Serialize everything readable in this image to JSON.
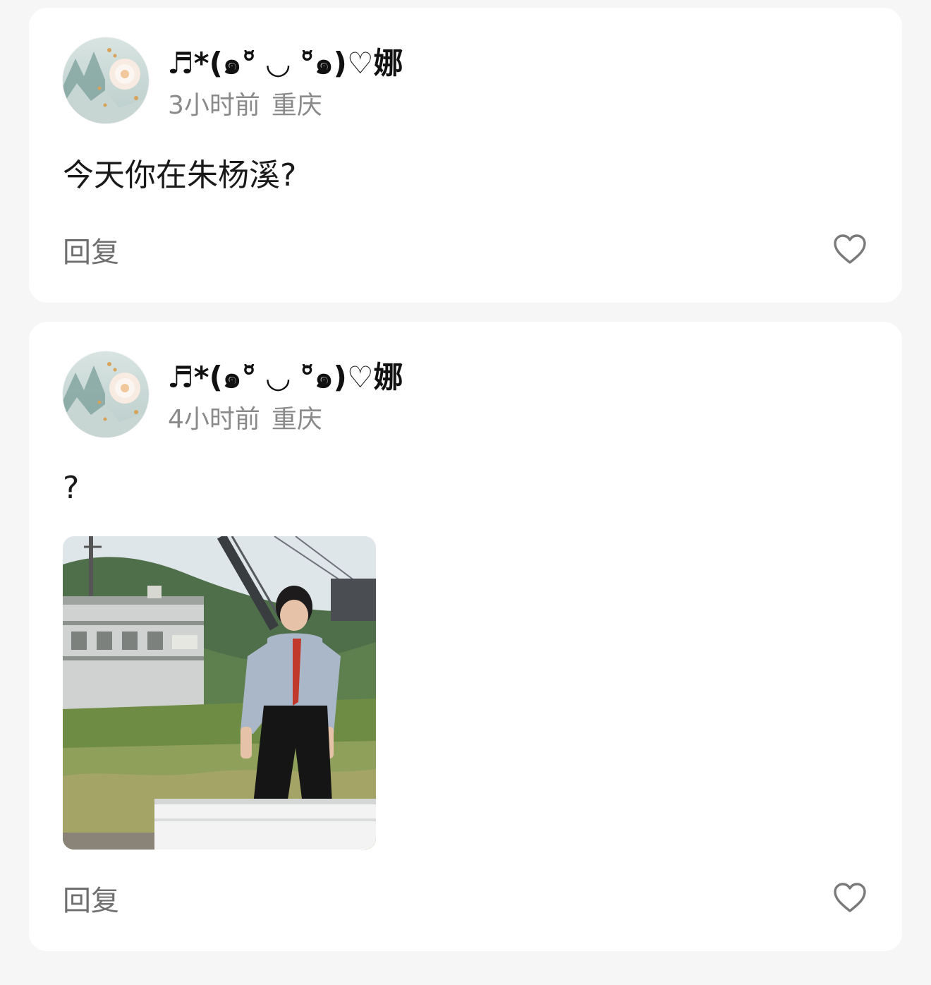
{
  "comments": [
    {
      "username": "♬*(๑°̆ ◡ °̆๑)♡娜",
      "time": "3小时前",
      "location": "重庆",
      "text": "今天你在朱杨溪?",
      "reply_label": "回复",
      "like_icon": "heart-outline-icon",
      "has_image": false
    },
    {
      "username": "♬*(๑°̆ ◡ °̆๑)♡娜",
      "time": "4小时前",
      "location": "重庆",
      "text": "?",
      "reply_label": "回复",
      "like_icon": "heart-outline-icon",
      "has_image": true
    }
  ],
  "colors": {
    "background": "#f6f6f6",
    "card": "#ffffff",
    "username": "#111111",
    "meta": "#8a8a8a",
    "reply": "#6f6f6f",
    "heart": "#7a7a7a"
  }
}
